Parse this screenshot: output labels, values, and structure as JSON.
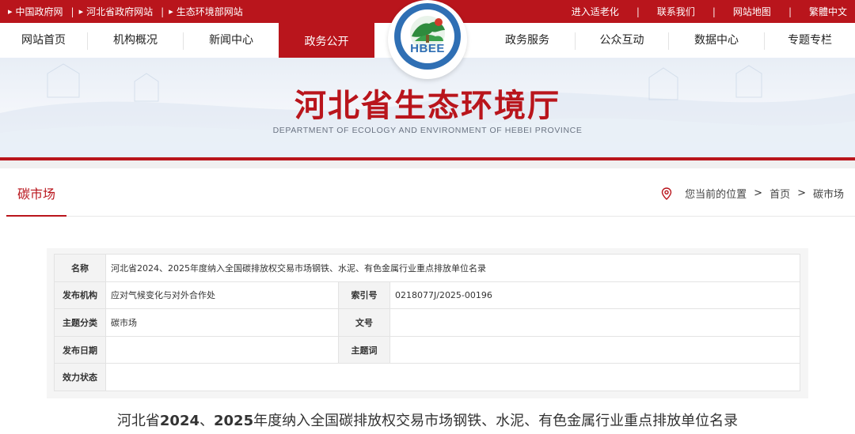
{
  "topbar": {
    "left_links": [
      "中国政府网",
      "河北省政府网站",
      "生态环境部网站"
    ],
    "right_links": [
      "进入适老化",
      "联系我们",
      "网站地图",
      "繁體中文"
    ]
  },
  "nav": {
    "items": [
      "网站首页",
      "机构概况",
      "新闻中心",
      "政务公开",
      "政务服务",
      "公众互动",
      "数据中心",
      "专题专栏"
    ],
    "active": "政务公开"
  },
  "logo": {
    "text": "HBEE"
  },
  "banner": {
    "title": "河北省生态环境厅",
    "subtitle": "DEPARTMENT OF ECOLOGY AND ENVIRONMENT OF HEBEI PROVINCE"
  },
  "section": {
    "title": "碳市场",
    "breadcrumb_prefix": "您当前的位置",
    "breadcrumb": [
      "首页",
      "碳市场"
    ]
  },
  "meta": {
    "name_label": "名称",
    "name_value": "河北省2024、2025年度纳入全国碳排放权交易市场钢铁、水泥、有色金属行业重点排放单位名录",
    "org_label": "发布机构",
    "org_value": "应对气候变化与对外合作处",
    "index_label": "索引号",
    "index_value": "0218077J/2025-00196",
    "topic_label": "主题分类",
    "topic_value": "碳市场",
    "doc_label": "文号",
    "doc_value": "",
    "date_label": "发布日期",
    "date_value": "",
    "keyword_label": "主题词",
    "keyword_value": "",
    "status_label": "效力状态",
    "status_value": ""
  },
  "article": {
    "title_pre": "河北省",
    "title_y1": "2024",
    "title_mid": "、",
    "title_y2": "2025",
    "title_post": "年度纳入全国碳排放权交易市场钢铁、水泥、有色金属行业重点排放单位名录"
  },
  "colors": {
    "brand_red": "#b9151c",
    "logo_blue": "#2f6fb4"
  }
}
